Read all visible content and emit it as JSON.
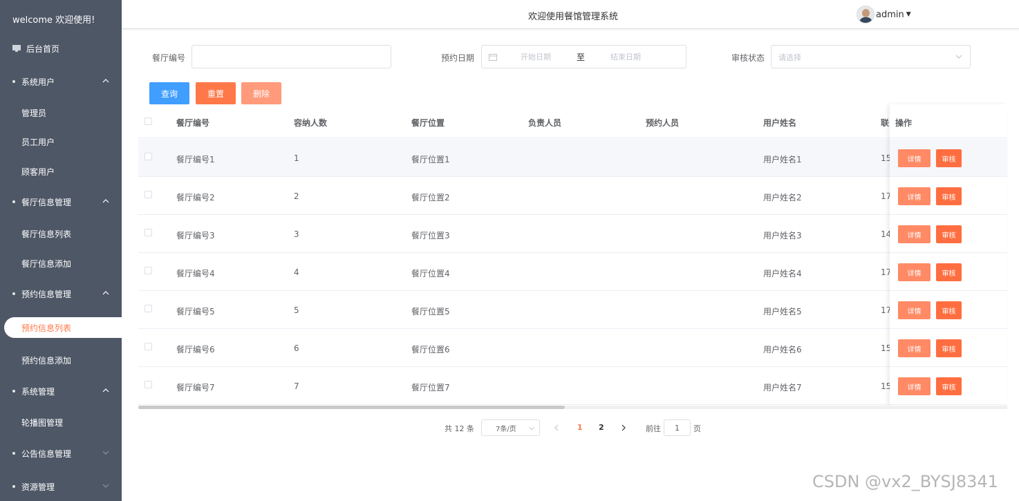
{
  "sidebar": {
    "brand": "welcome 欢迎使用!",
    "home": "后台首页",
    "groups": [
      {
        "label": "系统用户",
        "items": [
          "管理员",
          "员工用户",
          "顾客用户"
        ]
      },
      {
        "label": "餐厅信息管理",
        "items": [
          "餐厅信息列表",
          "餐厅信息添加"
        ]
      },
      {
        "label": "预约信息管理",
        "items": [
          "预约信息列表",
          "预约信息添加"
        ]
      },
      {
        "label": "系统管理",
        "items": [
          "轮播图管理"
        ]
      },
      {
        "label": "公告信息管理",
        "items": []
      },
      {
        "label": "资源管理",
        "items": []
      }
    ],
    "active_item": "预约信息列表"
  },
  "header": {
    "title": "欢迎使用餐馆管理系统",
    "user": "admin"
  },
  "search": {
    "restaurant_no_label": "餐厅编号",
    "restaurant_no_value": "",
    "date_label": "预约日期",
    "date_start_placeholder": "开始日期",
    "date_separator": "至",
    "date_end_placeholder": "结束日期",
    "status_label": "审核状态",
    "status_placeholder": "请选择"
  },
  "toolbar": {
    "query": "查询",
    "reset": "重置",
    "delete": "删除"
  },
  "colors": {
    "sidebar_bg": "#4e5766",
    "query_btn": "#409eff",
    "reset_btn": "#ff7849",
    "delete_btn": "#ff9a7a",
    "accent": "#ff7849"
  },
  "table": {
    "columns": [
      "餐厅编号",
      "容纳人数",
      "餐厅位置",
      "负责人员",
      "预约人员",
      "用户姓名",
      "联",
      "操作"
    ],
    "rows": [
      {
        "no": "餐厅编号1",
        "capacity": "1",
        "location": "餐厅位置1",
        "manager": "",
        "booker": "",
        "username": "用户姓名1",
        "contact": "15"
      },
      {
        "no": "餐厅编号2",
        "capacity": "2",
        "location": "餐厅位置2",
        "manager": "",
        "booker": "",
        "username": "用户姓名2",
        "contact": "17"
      },
      {
        "no": "餐厅编号3",
        "capacity": "3",
        "location": "餐厅位置3",
        "manager": "",
        "booker": "",
        "username": "用户姓名3",
        "contact": "14"
      },
      {
        "no": "餐厅编号4",
        "capacity": "4",
        "location": "餐厅位置4",
        "manager": "",
        "booker": "",
        "username": "用户姓名4",
        "contact": "17"
      },
      {
        "no": "餐厅编号5",
        "capacity": "5",
        "location": "餐厅位置5",
        "manager": "",
        "booker": "",
        "username": "用户姓名5",
        "contact": "17"
      },
      {
        "no": "餐厅编号6",
        "capacity": "6",
        "location": "餐厅位置6",
        "manager": "",
        "booker": "",
        "username": "用户姓名6",
        "contact": "15"
      },
      {
        "no": "餐厅编号7",
        "capacity": "7",
        "location": "餐厅位置7",
        "manager": "",
        "booker": "",
        "username": "用户姓名7",
        "contact": "15"
      }
    ],
    "action_detail": "详情",
    "action_audit": "审核"
  },
  "pagination": {
    "total": "共 12 条",
    "page_size": "7条/页",
    "pages": [
      "1",
      "2"
    ],
    "current": "1",
    "goto_label": "前往",
    "goto_value": "1",
    "goto_suffix": "页"
  },
  "watermark": "CSDN @vx2_BYSJ8341"
}
